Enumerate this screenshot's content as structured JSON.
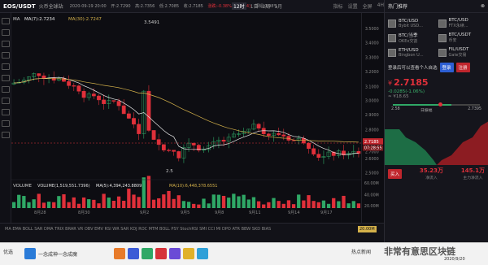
{
  "topbar": {
    "pair": "EOS/USDT",
    "exchange": "火币全球站",
    "ohlc": [
      "2020-09-19 20:00",
      "开:2.7290",
      "高:2.7356",
      "低:2.7085",
      "收:2.7185",
      "涨跌:-0.38%(-0.0104)",
      "振幅:0.98%"
    ],
    "timeframes": [
      "分时",
      "1分",
      "5分",
      "15分",
      "30分",
      "1时",
      "4时",
      "12时",
      "1日",
      "1周",
      "1月"
    ],
    "active_timeframe": "12时",
    "tools": [
      "指标",
      "设置",
      "全屏",
      "4H"
    ]
  },
  "chart": {
    "ma_label": "MA",
    "ma_values": [
      "MA(7):2.7234",
      "MA(30):2.7247"
    ],
    "annotation_high": "3.5491",
    "annotation_low": "2.5",
    "volume_label": "VOLUME",
    "volume_values": [
      "VOLUME(1,519,551.7396)",
      "MA(5):4,394,243.8809",
      "MA(10):6,448,378.6551"
    ],
    "price_axis": [
      "3.5000",
      "3.4000",
      "3.3000",
      "3.2000",
      "3.1000",
      "3.0000",
      "2.9000",
      "2.8000",
      "2.7000",
      "2.6000",
      "2.5000"
    ],
    "current_price": "2.7185",
    "countdown": "07:28:55",
    "volume_axis": [
      "60.00M",
      "40.00M",
      "20.00M"
    ],
    "date_labels": [
      "8月28",
      "8月30",
      "9月2",
      "9月5",
      "9月8",
      "9月11",
      "9月14",
      "9月17"
    ],
    "indicators": [
      "MA",
      "EMA",
      "BOLL",
      "SAR",
      "DMA",
      "TRIX",
      "BRAR",
      "VR",
      "OBV",
      "EMV",
      "RSI",
      "WR",
      "SAR",
      "KDJ",
      "ROC",
      "MTM",
      "BOLL",
      "PSY",
      "StochRSI",
      "SMI",
      "CCI",
      "MI",
      "DPO",
      "ATR",
      "BBW",
      "SKD",
      "BIAS"
    ]
  },
  "rpanel": {
    "title": "热门推荐",
    "pairs": [
      {
        "name": "BTC/USD",
        "exchange": "Bybit USD..."
      },
      {
        "name": "BTC/USD",
        "exchange": "FTX永续..."
      },
      {
        "name": "BTC/当季",
        "exchange": "OKEx交割"
      },
      {
        "name": "BTC/USDT",
        "exchange": "币安"
      },
      {
        "name": "ETH/USD",
        "exchange": "Bingbon U..."
      },
      {
        "name": "FIL/USDT",
        "exchange": "Gate交易"
      }
    ],
    "login_prompt": "登录后可以查看个人自选",
    "login_btn": "登录",
    "register_btn": "注册",
    "price": "2.7185",
    "change": "-0.0285(-1.06%)",
    "cny": "≈ ¥18.65",
    "range_low": "2.58",
    "range_high": "2.7395",
    "range_label": "日振幅",
    "hold_label": "持仓量",
    "buy_label": "买入",
    "sell_label": "卖出",
    "stat1_value": "35.23万",
    "stat2_value": "145.1万",
    "stat1_label": "净流入",
    "stat2_label": "主力净流入"
  },
  "taskbar": {
    "left": "优选",
    "tab": "一念成神一念成魔",
    "right_label": "热点新闻",
    "time": "2020/9/20"
  },
  "watermark": "非常有意思区块链"
}
